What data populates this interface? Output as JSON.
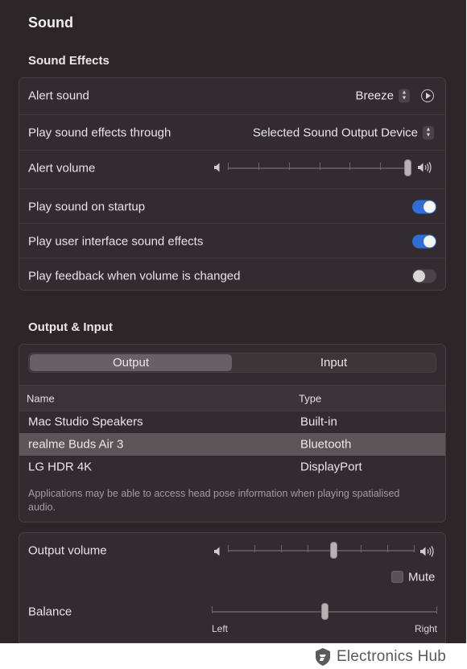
{
  "page_title": "Sound",
  "sound_effects": {
    "section_title": "Sound Effects",
    "alert_sound": {
      "label": "Alert sound",
      "value": "Breeze"
    },
    "play_through": {
      "label": "Play sound effects through",
      "value": "Selected Sound Output Device"
    },
    "alert_volume": {
      "label": "Alert volume",
      "level": 1.0
    },
    "startup": {
      "label": "Play sound on startup",
      "on": true
    },
    "ui_effects": {
      "label": "Play user interface sound effects",
      "on": true
    },
    "feedback": {
      "label": "Play feedback when volume is changed",
      "on": false
    }
  },
  "output_input": {
    "section_title": "Output & Input",
    "tabs": [
      "Output",
      "Input"
    ],
    "selected_tab": "Output",
    "columns": {
      "name": "Name",
      "type": "Type"
    },
    "devices": [
      {
        "name": "Mac Studio Speakers",
        "type": "Built-in",
        "selected": false
      },
      {
        "name": "realme Buds Air 3",
        "type": "Bluetooth",
        "selected": true
      },
      {
        "name": "LG HDR 4K",
        "type": "DisplayPort",
        "selected": false
      }
    ],
    "note": "Applications may be able to access head pose information when playing spatialised audio."
  },
  "output_controls": {
    "output_volume": {
      "label": "Output volume",
      "level": 0.57
    },
    "mute": {
      "label": "Mute",
      "checked": false
    },
    "balance": {
      "label": "Balance",
      "level": 0.5,
      "left_label": "Left",
      "right_label": "Right"
    }
  },
  "watermark": {
    "text": "Electronics Hub"
  },
  "colors": {
    "accent": "#2f6ed6",
    "background": "#2c2629"
  }
}
